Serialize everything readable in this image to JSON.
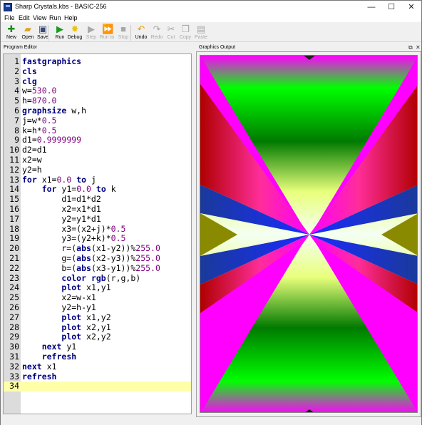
{
  "window": {
    "title": "Sharp Crystals.kbs - BASIC-256",
    "minimize": "—",
    "maximize": "☐",
    "close": "✕"
  },
  "menu": [
    "File",
    "Edit",
    "View",
    "Run",
    "Help"
  ],
  "toolbar": [
    {
      "label": "New",
      "icon": "new-icon",
      "glyph": "✚",
      "color": "#1e8a1e",
      "enabled": true
    },
    {
      "label": "Open",
      "icon": "open-folder-icon",
      "glyph": "▰",
      "color": "#d9a52b",
      "enabled": true
    },
    {
      "label": "Save",
      "icon": "save-icon",
      "glyph": "▣",
      "color": "#3a4a7a",
      "enabled": true
    },
    {
      "label": "Run",
      "icon": "run-icon",
      "glyph": "▶",
      "color": "#1e9a1e",
      "enabled": true
    },
    {
      "label": "Debug",
      "icon": "debug-icon",
      "glyph": "✸",
      "color": "#e8c21a",
      "enabled": true
    },
    {
      "label": "Step",
      "icon": "step-icon",
      "glyph": "▶",
      "color": "#a8a8a8",
      "enabled": false
    },
    {
      "label": "Run to",
      "icon": "run-to-icon",
      "glyph": "⏩",
      "color": "#a8a8a8",
      "enabled": false
    },
    {
      "label": "Stop",
      "icon": "stop-icon",
      "glyph": "■",
      "color": "#a8a8a8",
      "enabled": false
    },
    {
      "label": "Undo",
      "icon": "undo-icon",
      "glyph": "↶",
      "color": "#e3a21a",
      "enabled": true
    },
    {
      "label": "Redo",
      "icon": "redo-icon",
      "glyph": "↷",
      "color": "#a8a8a8",
      "enabled": false
    },
    {
      "label": "Cut",
      "icon": "cut-icon",
      "glyph": "✂",
      "color": "#a8a8a8",
      "enabled": false
    },
    {
      "label": "Copy",
      "icon": "copy-icon",
      "glyph": "❐",
      "color": "#a8a8a8",
      "enabled": false
    },
    {
      "label": "Paste",
      "icon": "paste-icon",
      "glyph": "▤",
      "color": "#a8a8a8",
      "enabled": false
    }
  ],
  "editor": {
    "title": "Program Editor",
    "current_line": 34,
    "lines": [
      [
        {
          "t": "fastgraphics",
          "c": "kw"
        }
      ],
      [
        {
          "t": "cls",
          "c": "kw"
        }
      ],
      [
        {
          "t": "clg",
          "c": "kw"
        }
      ],
      [
        {
          "t": "w="
        },
        {
          "t": "530.0",
          "c": "num"
        }
      ],
      [
        {
          "t": "h="
        },
        {
          "t": "870.0",
          "c": "num"
        }
      ],
      [
        {
          "t": "graphsize",
          "c": "kw"
        },
        {
          "t": " w,h"
        }
      ],
      [
        {
          "t": "j=w*"
        },
        {
          "t": "0.5",
          "c": "num"
        }
      ],
      [
        {
          "t": "k=h*"
        },
        {
          "t": "0.5",
          "c": "num"
        }
      ],
      [
        {
          "t": "d1="
        },
        {
          "t": "0.9999999",
          "c": "num"
        }
      ],
      [
        {
          "t": "d2=d1"
        }
      ],
      [
        {
          "t": "x2=w"
        }
      ],
      [
        {
          "t": "y2=h"
        }
      ],
      [
        {
          "t": "for",
          "c": "kw"
        },
        {
          "t": " x1="
        },
        {
          "t": "0.0",
          "c": "num"
        },
        {
          "t": " "
        },
        {
          "t": "to",
          "c": "kw"
        },
        {
          "t": " j"
        }
      ],
      [
        {
          "t": "    "
        },
        {
          "t": "for",
          "c": "kw"
        },
        {
          "t": " y1="
        },
        {
          "t": "0.0",
          "c": "num"
        },
        {
          "t": " "
        },
        {
          "t": "to",
          "c": "kw"
        },
        {
          "t": " k"
        }
      ],
      [
        {
          "t": "        d1=d1*d2"
        }
      ],
      [
        {
          "t": "        x2=x1*d1"
        }
      ],
      [
        {
          "t": "        y2=y1*d1"
        }
      ],
      [
        {
          "t": "        x3=(x2+j)*"
        },
        {
          "t": "0.5",
          "c": "num"
        }
      ],
      [
        {
          "t": "        y3=(y2+k)*"
        },
        {
          "t": "0.5",
          "c": "num"
        }
      ],
      [
        {
          "t": "        r=("
        },
        {
          "t": "abs",
          "c": "kw"
        },
        {
          "t": "(x1-y2))%"
        },
        {
          "t": "255.0",
          "c": "num"
        }
      ],
      [
        {
          "t": "        g=("
        },
        {
          "t": "abs",
          "c": "kw"
        },
        {
          "t": "(x2-y3))%"
        },
        {
          "t": "255.0",
          "c": "num"
        }
      ],
      [
        {
          "t": "        b=("
        },
        {
          "t": "abs",
          "c": "kw"
        },
        {
          "t": "(x3-y1))%"
        },
        {
          "t": "255.0",
          "c": "num"
        }
      ],
      [
        {
          "t": "        "
        },
        {
          "t": "color",
          "c": "kw"
        },
        {
          "t": " "
        },
        {
          "t": "rgb",
          "c": "kw"
        },
        {
          "t": "(r,g,b)"
        }
      ],
      [
        {
          "t": "        "
        },
        {
          "t": "plot",
          "c": "kw"
        },
        {
          "t": " x1,y1"
        }
      ],
      [
        {
          "t": "        x2=w-x1"
        }
      ],
      [
        {
          "t": "        y2=h-y1"
        }
      ],
      [
        {
          "t": "        "
        },
        {
          "t": "plot",
          "c": "kw"
        },
        {
          "t": " x1,y2"
        }
      ],
      [
        {
          "t": "        "
        },
        {
          "t": "plot",
          "c": "kw"
        },
        {
          "t": " x2,y1"
        }
      ],
      [
        {
          "t": "        "
        },
        {
          "t": "plot",
          "c": "kw"
        },
        {
          "t": " x2,y2"
        }
      ],
      [
        {
          "t": "    "
        },
        {
          "t": "next",
          "c": "kw"
        },
        {
          "t": " y1"
        }
      ],
      [
        {
          "t": "    "
        },
        {
          "t": "refresh",
          "c": "kw"
        }
      ],
      [
        {
          "t": "next",
          "c": "kw"
        },
        {
          "t": " x1"
        }
      ],
      [
        {
          "t": "refresh",
          "c": "kw"
        }
      ],
      []
    ]
  },
  "graphics": {
    "title": "Graphics Output",
    "float_icon": "float-window-icon",
    "close_icon": "close-panel-icon",
    "colors": {
      "magenta": "#ff00ff",
      "green": "#00ff00",
      "dark_green": "#007a00",
      "white_center": "#f4fff4",
      "yellow_green": "#e8ff7a",
      "red": "#b00000",
      "pink": "#ff2d9a",
      "blue": "#1a2bff",
      "olive": "#8a8a00",
      "dark": "#202020"
    }
  }
}
